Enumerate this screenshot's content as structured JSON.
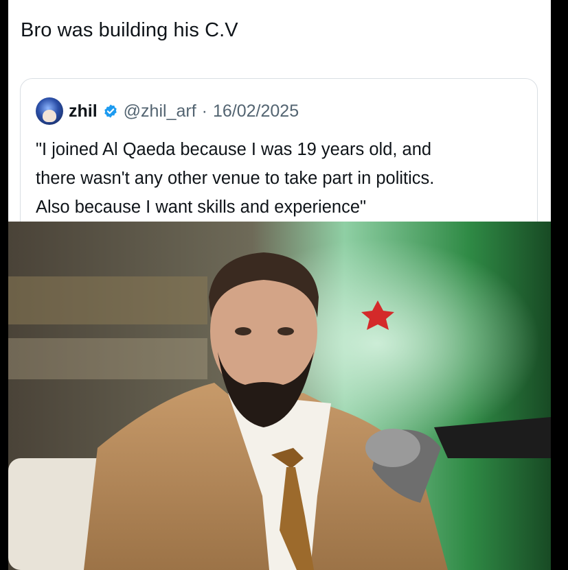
{
  "post": {
    "text": "Bro was building his C.V"
  },
  "quote": {
    "author_name": "zhil",
    "handle": "@zhil_arf",
    "separator": "·",
    "date": "16/02/2025",
    "text_lines": [
      "\"I joined Al Qaeda because I was 19 years old, and",
      "there wasn't any other venue to take part in politics.",
      "Also because I want skills and experience\""
    ],
    "icons": {
      "avatar": "avatar-image",
      "badge": "verified-badge-icon"
    }
  },
  "colors": {
    "text": "#0f1419",
    "muted": "#536471",
    "verified": "#1d9bf0",
    "border": "#d9dee3"
  }
}
